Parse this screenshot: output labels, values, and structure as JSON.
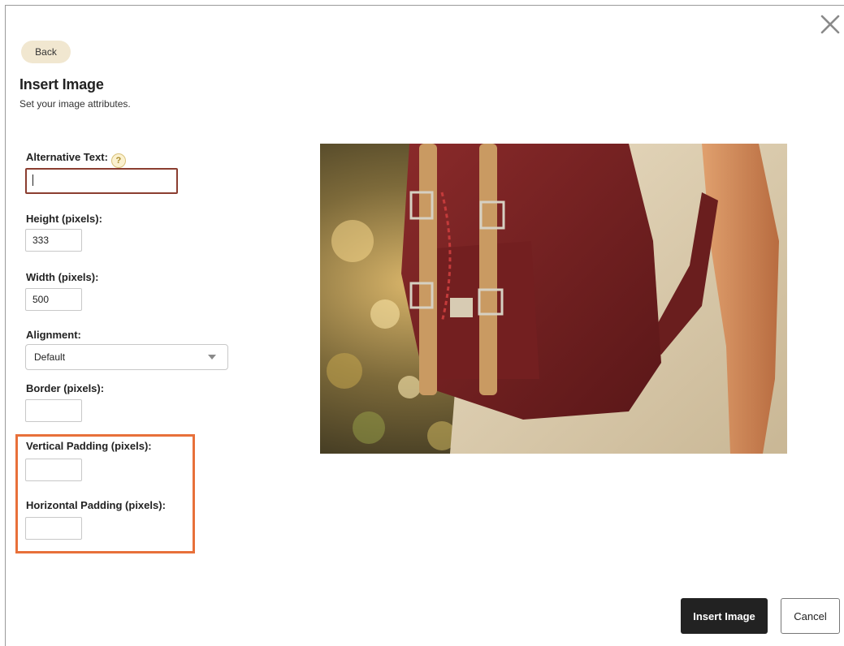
{
  "dialog": {
    "back_label": "Back",
    "title": "Insert Image",
    "subtitle": "Set your image attributes.",
    "close_icon": "close-icon"
  },
  "fields": {
    "alt_text": {
      "label": "Alternative Text:",
      "help_glyph": "?",
      "value": ""
    },
    "height": {
      "label": "Height (pixels):",
      "value": "333"
    },
    "width": {
      "label": "Width (pixels):",
      "value": "500"
    },
    "alignment": {
      "label": "Alignment:",
      "selected": "Default"
    },
    "border": {
      "label": "Border (pixels):",
      "value": ""
    },
    "vertical_padding": {
      "label": "Vertical Padding (pixels):",
      "value": ""
    },
    "horizontal_padding": {
      "label": "Horizontal Padding (pixels):",
      "value": ""
    }
  },
  "actions": {
    "insert_label": "Insert Image",
    "cancel_label": "Cancel"
  },
  "colors": {
    "highlight": "#e8703a",
    "alt_focus_border": "#8b3e30",
    "back_button_bg": "#f1e7d0",
    "primary_button_bg": "#222222"
  }
}
